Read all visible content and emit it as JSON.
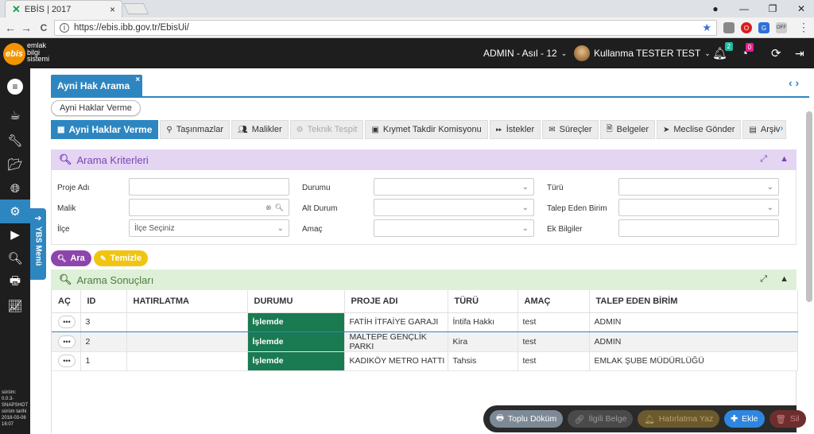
{
  "browser": {
    "tab_title": "EBİS | 2017",
    "tab_close": "×",
    "url": "https://ebis.ibb.gov.tr/EbisUi/",
    "back": "←",
    "forward": "→",
    "reload": "C",
    "win_min": "—",
    "win_max": "❐",
    "win_close": "✕"
  },
  "app": {
    "logo": "ebis",
    "logo_line1": "emlak",
    "logo_line2": "bilgi",
    "logo_line3": "sistemi",
    "role": "ADMIN - Asıl - 12",
    "user": "Kullanma TESTER TEST",
    "notif_count": "2",
    "task_count": "0"
  },
  "sidebar": {
    "version_lines": [
      "sürüm:",
      "0.0.3-",
      "SNAPSHOT",
      "sürüm tarihi",
      "2018-03-06",
      "16:07"
    ],
    "ybs_label": "YBS Menü"
  },
  "doc_tab": {
    "label": "Ayni Hak Arama",
    "close": "×"
  },
  "breadcrumb_pill": "Ayni Haklar Verme",
  "subtabs": [
    {
      "label": "Ayni Haklar Verme"
    },
    {
      "label": "Taşınmazlar"
    },
    {
      "label": "Malikler"
    },
    {
      "label": "Teknik Tespit"
    },
    {
      "label": "Kıymet Takdir Komisyonu"
    },
    {
      "label": "İstekler"
    },
    {
      "label": "Süreçler"
    },
    {
      "label": "Belgeler"
    },
    {
      "label": "Meclise Gönder"
    },
    {
      "label": "Arşiv"
    }
  ],
  "criteria": {
    "title": "Arama Kriterleri",
    "labels": {
      "proje_adi": "Proje Adı",
      "malik": "Malik",
      "ilce": "İlçe",
      "durumu": "Durumu",
      "alt_durum": "Alt Durum",
      "amac": "Amaç",
      "turu": "Türü",
      "talep_eden_birim": "Talep Eden Birim",
      "ek_bilgiler": "Ek Bilgiler"
    },
    "ilce_placeholder": "İlçe Seçiniz",
    "search_button": "Ara",
    "clear_button": "Temizle"
  },
  "results": {
    "title": "Arama Sonuçları",
    "columns": [
      "AÇ",
      "ID",
      "HATIRLATMA",
      "DURUMU",
      "PROJE ADI",
      "TÜRÜ",
      "AMAÇ",
      "TALEP EDEN BİRİM"
    ],
    "rows": [
      {
        "ac": "•••",
        "id": "3",
        "hatirlatma": "",
        "durumu": "İşlemde",
        "proje_adi": "FATİH İTFAİYE GARAJI",
        "turu": "İntifa Hakkı",
        "amac": "test",
        "talep_eden_birim": "ADMIN"
      },
      {
        "ac": "•••",
        "id": "2",
        "hatirlatma": "",
        "durumu": "İşlemde",
        "proje_adi": "MALTEPE GENÇLİK PARKI",
        "turu": "Kira",
        "amac": "test",
        "talep_eden_birim": "ADMIN"
      },
      {
        "ac": "•••",
        "id": "1",
        "hatirlatma": "",
        "durumu": "İşlemde",
        "proje_adi": "KADIKÖY METRO HATTI",
        "turu": "Tahsis",
        "amac": "test",
        "talep_eden_birim": "EMLAK ŞUBE MÜDÜRLÜĞÜ"
      }
    ]
  },
  "toolbar": {
    "toplu_dokum": "Toplu Döküm",
    "ilgili_belge": "İlgili Belge",
    "hatirlatma_yaz": "Hatırlatma Yaz",
    "ekle": "Ekle",
    "sil": "Sil"
  },
  "colors": {
    "accent": "#2e86c1",
    "status": "#1a7a52",
    "search": "#8e44ad",
    "clear": "#f1c40f",
    "dark": "#1e1e1e"
  }
}
